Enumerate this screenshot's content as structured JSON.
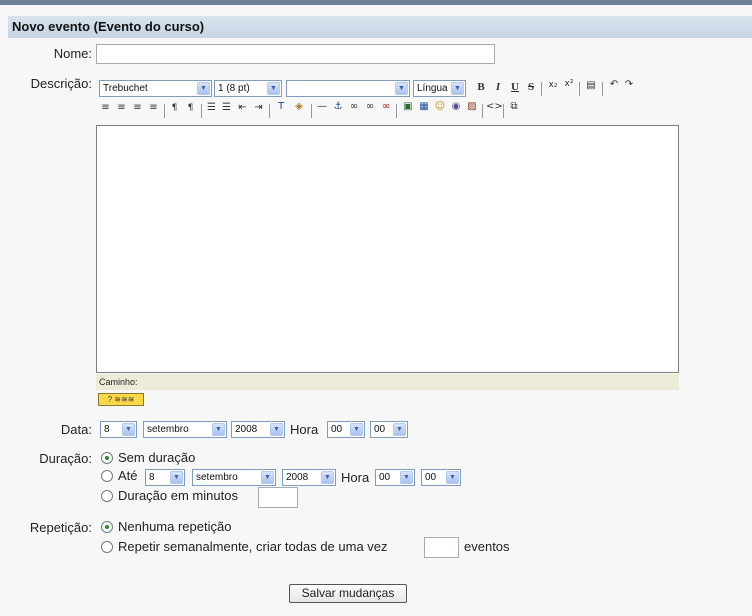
{
  "header": {
    "title": "Novo evento (Evento do curso)"
  },
  "labels": {
    "nome": "Nome:",
    "descricao": "Descrição:",
    "data": "Data:",
    "duracao": "Duração:",
    "repeticao": "Repetição:"
  },
  "nome": {
    "value": ""
  },
  "toolbar": {
    "font": "Trebuchet",
    "size": "1 (8 pt)",
    "format": "",
    "language": "Língua",
    "bold": "B",
    "italic": "I",
    "underline": "U",
    "strike": "S"
  },
  "editor": {
    "path_label": "Caminho:",
    "content": ""
  },
  "data": {
    "day": "8",
    "month": "setembro",
    "year": "2008",
    "hora_label": "Hora",
    "hour": "00",
    "minute": "00"
  },
  "duracao": {
    "option_none": "Sem duração",
    "option_until": "Até",
    "until_day": "8",
    "until_month": "setembro",
    "until_year": "2008",
    "hora_label": "Hora",
    "until_hour": "00",
    "until_minute": "00",
    "option_minutes": "Duração em minutos",
    "minutes_value": "",
    "selected": "none"
  },
  "repeticao": {
    "option_none": "Nenhuma repetição",
    "option_weekly": "Repetir semanalmente, criar todas de uma vez",
    "weeks_value": "",
    "weeks_suffix": "eventos",
    "selected": "none"
  },
  "submit_label": "Salvar mudanças"
}
